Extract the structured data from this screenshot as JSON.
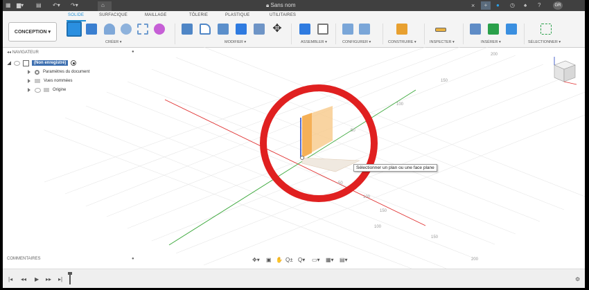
{
  "window": {
    "title": "Sans nom",
    "user_initials": "GR"
  },
  "ribbon": {
    "tabs": [
      "SOLIDE",
      "SURFACIQUE",
      "MAILLAGE",
      "TÔLERIE",
      "PLASTIQUE",
      "UTILITAIRES"
    ],
    "workspace": "CONCEPTION ▾",
    "groups": [
      "CRÉER ▾",
      "MODIFIER ▾",
      "ASSEMBLER ▾",
      "CONFIGURER ▾",
      "CONSTRUIRE ▾",
      "INSPECTER ▾",
      "INSÉRER ▾",
      "SÉLECTIONNER ▾"
    ]
  },
  "browser": {
    "header": "NAVIGATEUR",
    "root": "(Non enregistré)",
    "items": [
      "Paramètres du document",
      "Vues nommées",
      "Origine"
    ]
  },
  "comments": {
    "header": "COMMENTAIRES"
  },
  "canvas": {
    "tooltip": "Sélectionner un plan ou une face plane",
    "dims": [
      "200",
      "150",
      "100",
      "50",
      "50",
      "100",
      "150",
      "100",
      "150",
      "200"
    ]
  },
  "colors": {
    "accent": "#1e8fd6",
    "x_axis": "#e03030",
    "y_axis": "#3aa83a",
    "z_axis": "#2040c0",
    "plane": "#f5b45a",
    "highlight_circle": "#e02020"
  },
  "icons": [
    "grid-menu-icon",
    "file-icon",
    "save-icon",
    "undo-icon",
    "redo-icon",
    "home-icon",
    "lock-icon",
    "close-icon",
    "add-icon",
    "extensions-icon",
    "history-icon",
    "notifications-icon",
    "help-icon",
    "settings-icon"
  ]
}
